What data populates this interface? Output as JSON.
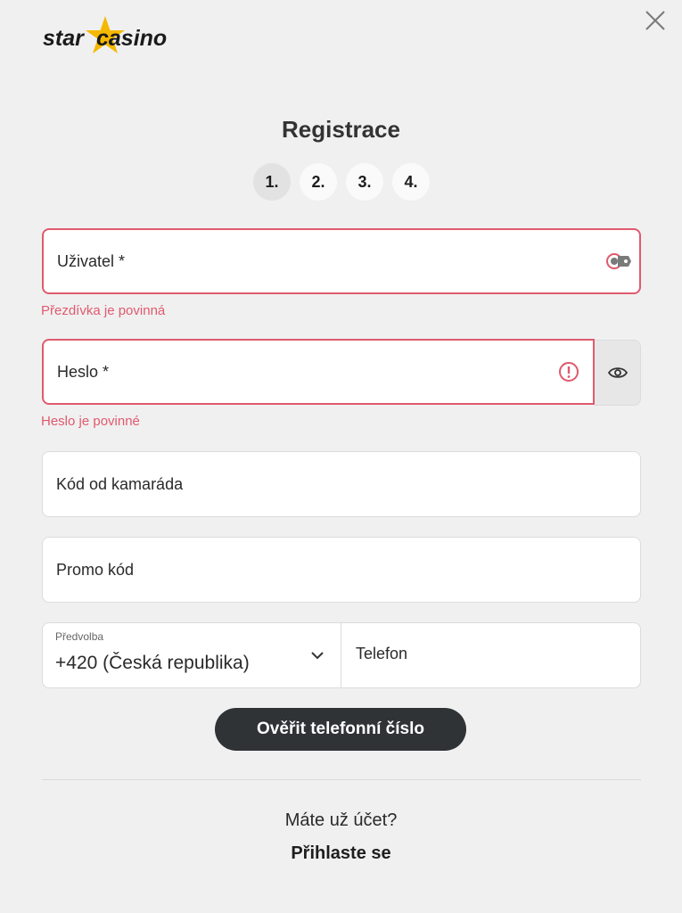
{
  "brand": {
    "logo_text_left": "star",
    "logo_text_right": "casino",
    "star_color": "#f5b800"
  },
  "header": {
    "close_icon": "close-icon"
  },
  "title": "Registrace",
  "steps": [
    {
      "label": "1.",
      "active": true
    },
    {
      "label": "2.",
      "active": false
    },
    {
      "label": "3.",
      "active": false
    },
    {
      "label": "4.",
      "active": false
    }
  ],
  "form": {
    "username": {
      "placeholder": "Uživatel *",
      "value": "",
      "error": "Přezdívka je povinná",
      "icon": "autofill-key-icon"
    },
    "password": {
      "placeholder": "Heslo *",
      "value": "",
      "error": "Heslo je povinné",
      "icon": "error-exclamation-icon",
      "toggle_icon": "eye-icon"
    },
    "friend_code": {
      "placeholder": "Kód od kamaráda",
      "value": ""
    },
    "promo_code": {
      "placeholder": "Promo kód",
      "value": ""
    },
    "phone_prefix": {
      "label": "Předvolba",
      "value": "+420 (Česká republika)"
    },
    "phone": {
      "placeholder": "Telefon",
      "value": ""
    }
  },
  "verify_button": "Ověřit telefonní číslo",
  "footer": {
    "question": "Máte už účet?",
    "login_link": "Přihlaste se"
  },
  "colors": {
    "error": "#e05a6e",
    "button_bg": "#2f3336",
    "background": "#f0f0f0"
  }
}
